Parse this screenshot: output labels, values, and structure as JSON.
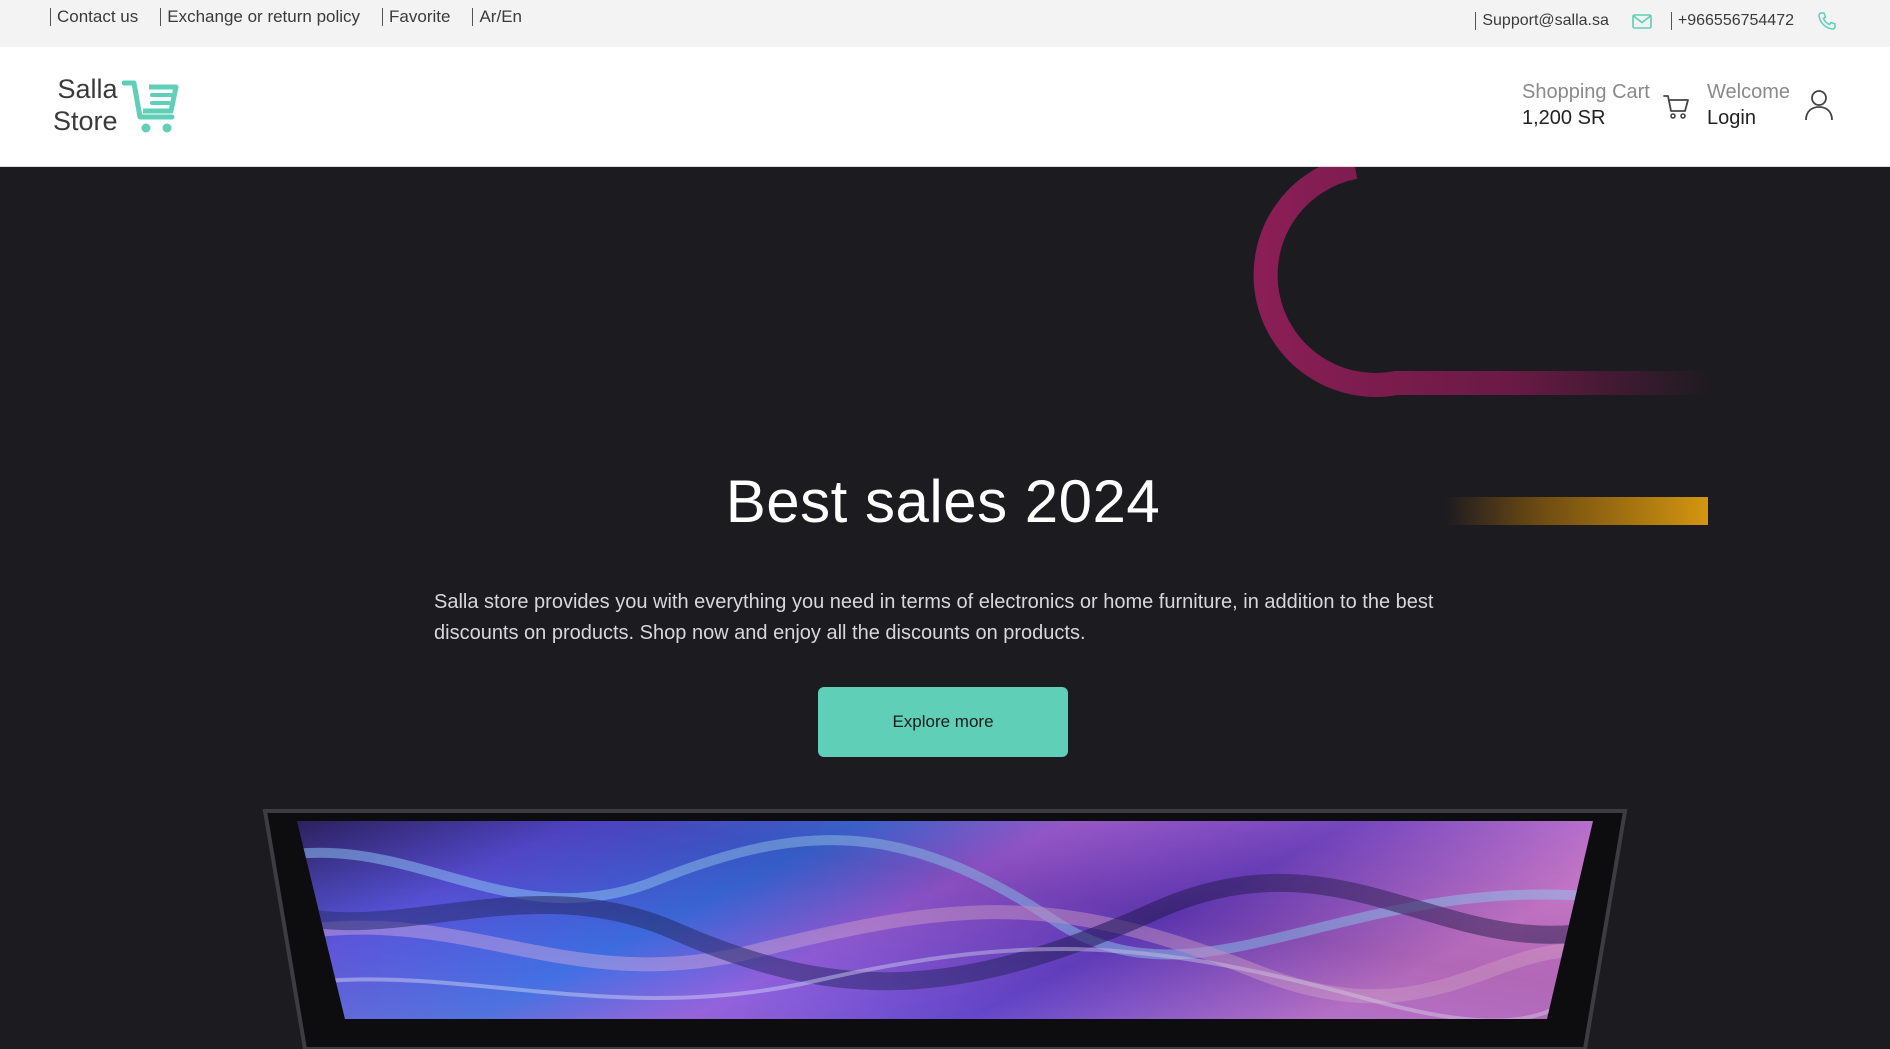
{
  "topbar": {
    "links": [
      {
        "label": "Contact us"
      },
      {
        "label": "Exchange or return policy"
      },
      {
        "label": "Favorite"
      },
      {
        "label": "Ar/En"
      }
    ],
    "email": "Support@salla.sa",
    "phone": "+966556754472",
    "email_icon": "mail-icon",
    "phone_icon": "phone-icon"
  },
  "header": {
    "logo": {
      "line1": "Salla",
      "line2": "Store",
      "icon": "cart-icon"
    },
    "cart": {
      "label": "Shopping Cart",
      "amount": "1,200 SR",
      "icon": "cart-icon"
    },
    "user": {
      "greeting": "Welcome",
      "action": "Login",
      "icon": "user-icon"
    }
  },
  "hero": {
    "title": "Best sales 2024",
    "description": "Salla store provides you with everything you need in terms of electronics or home furniture, in addition to the best discounts on products. Shop now and enjoy all the discounts on products.",
    "cta_label": "Explore more"
  },
  "colors": {
    "accent": "#5fcfb7",
    "hero_background": "#1c1b20",
    "decor_magenta": "#8a1e55",
    "decor_gold": "#d4960f"
  }
}
